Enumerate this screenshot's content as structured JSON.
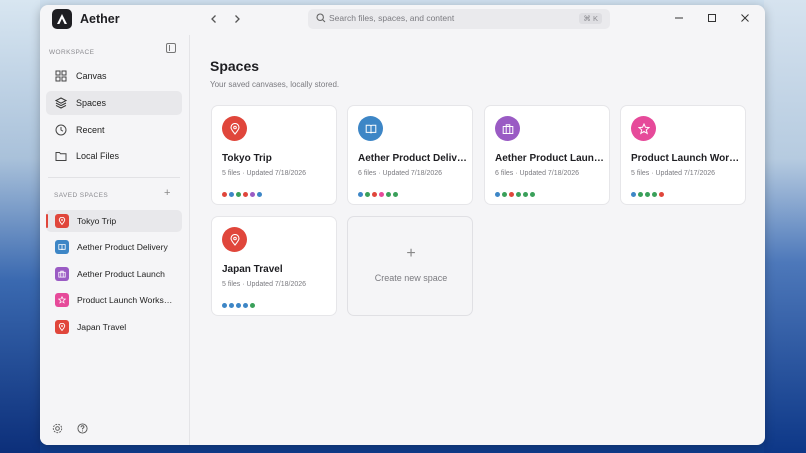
{
  "app": {
    "name": "Aether"
  },
  "search": {
    "placeholder": "Search files, spaces, and content",
    "shortcut": "⌘ K"
  },
  "sidebar": {
    "workspace_label": "WORKSPACE",
    "nav": [
      {
        "label": "Canvas",
        "icon": "grid-icon"
      },
      {
        "label": "Spaces",
        "icon": "layers-icon",
        "active": true
      },
      {
        "label": "Recent",
        "icon": "clock-icon"
      },
      {
        "label": "Local Files",
        "icon": "folder-icon"
      }
    ],
    "saved_label": "SAVED SPACES",
    "add_label": "+",
    "saved": [
      {
        "label": "Tokyo Trip",
        "icon": "map-pin-icon",
        "color": "#e0463b",
        "active": true
      },
      {
        "label": "Aether Product Delivery",
        "icon": "book-icon",
        "color": "#3d86c6"
      },
      {
        "label": "Aether Product Launch",
        "icon": "briefcase-icon",
        "color": "#9a5bc4"
      },
      {
        "label": "Product Launch Workshop",
        "icon": "star-icon",
        "color": "#e64a9a"
      },
      {
        "label": "Japan Travel",
        "icon": "map-pin-icon",
        "color": "#e0463b"
      }
    ]
  },
  "main": {
    "title": "Spaces",
    "subtitle": "Your saved canvases, locally stored.",
    "cards": [
      {
        "name": "Tokyo Trip",
        "meta": "5 files · Updated 7/18/2026",
        "icon": "map-pin-icon",
        "color": "#e0463b",
        "dots": [
          "#e0463b",
          "#3d86c6",
          "#3aa05a",
          "#e0463b",
          "#9a5bc4",
          "#3d86c6"
        ]
      },
      {
        "name": "Aether Product Delivery",
        "meta": "6 files · Updated 7/18/2026",
        "icon": "book-icon",
        "color": "#3d86c6",
        "dots": [
          "#3d86c6",
          "#3aa05a",
          "#e0463b",
          "#e64a9a",
          "#3aa05a",
          "#3aa05a"
        ]
      },
      {
        "name": "Aether Product Launch",
        "meta": "6 files · Updated 7/18/2026",
        "icon": "briefcase-icon",
        "color": "#9a5bc4",
        "dots": [
          "#3d86c6",
          "#3aa05a",
          "#e0463b",
          "#3aa05a",
          "#3aa05a",
          "#3aa05a"
        ]
      },
      {
        "name": "Product Launch Workshop",
        "meta": "5 files · Updated 7/17/2026",
        "icon": "star-icon",
        "color": "#e64a9a",
        "dots": [
          "#3d86c6",
          "#3aa05a",
          "#3aa05a",
          "#3aa05a",
          "#e0463b"
        ]
      },
      {
        "name": "Japan Travel",
        "meta": "5 files · Updated 7/18/2026",
        "icon": "map-pin-icon",
        "color": "#e0463b",
        "dots": [
          "#3d86c6",
          "#3d86c6",
          "#3d86c6",
          "#3d86c6",
          "#3aa05a"
        ]
      }
    ],
    "new_space": {
      "plus": "+",
      "label": "Create new space"
    }
  }
}
